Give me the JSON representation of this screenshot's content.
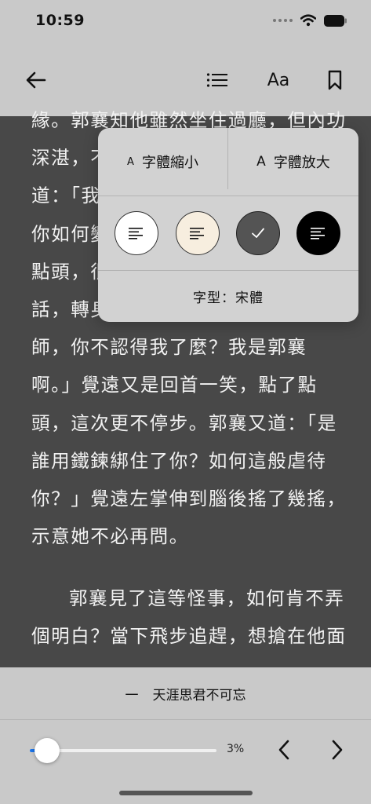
{
  "status_bar": {
    "time": "10:59"
  },
  "toolbar": {
    "back_icon": "back-arrow-icon",
    "toc_icon": "list-icon",
    "font_label": "Aa",
    "bookmark_icon": "bookmark-icon"
  },
  "reading": {
    "lines": [
      "緣。郭襄知他雖然坐住過廳，但內功",
      "深湛，不",
      "道：「我",
      "你如何變",
      "點頭，很",
      "話，轉身",
      "師，你不認得我了麼？我是郭襄",
      "啊。」覺遠又是回首一笑，點了點",
      "頭，這次更不停步。郭襄又道：「是",
      "誰用鐵鍊綁住了你？如何這般虐待",
      "你？」覺遠左掌伸到腦後搖了幾搖，",
      "示意她不必再問。",
      "郭襄見了這等怪事，如何肯不弄",
      "個明白？當下飛步追趕，想搶在他面"
    ]
  },
  "popover": {
    "shrink_icon": "A",
    "shrink_label": "字體縮小",
    "enlarge_icon": "A",
    "enlarge_label": "字體放大",
    "themes": [
      {
        "name": "white",
        "color": "#ffffff",
        "selected": false
      },
      {
        "name": "sepia",
        "color": "#f7eedf",
        "selected": false
      },
      {
        "name": "gray",
        "color": "#545454",
        "selected": true
      },
      {
        "name": "black",
        "color": "#000000",
        "selected": false
      }
    ],
    "font_face_label": "字型：宋體"
  },
  "chapter": {
    "dash": "一",
    "title": "天涯思君不可忘"
  },
  "progress": {
    "value": 0.03,
    "label": "3%"
  },
  "colors": {
    "accent": "#1a73e8",
    "reading_background": "#484848",
    "chrome_background": "#c9c9c9"
  }
}
